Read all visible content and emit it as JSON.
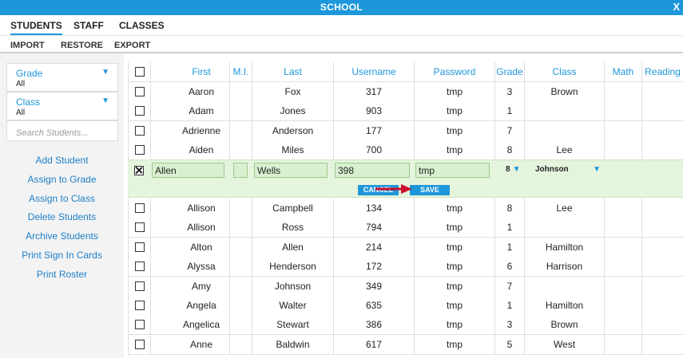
{
  "window": {
    "title": "SCHOOL",
    "close": "X"
  },
  "tabs": [
    {
      "label": "STUDENTS",
      "active": true
    },
    {
      "label": "STAFF",
      "active": false
    },
    {
      "label": "CLASSES",
      "active": false
    }
  ],
  "actions": {
    "import": "IMPORT",
    "restore": "RESTORE",
    "export": "EXPORT"
  },
  "filters": {
    "grade": {
      "label": "Grade",
      "value": "All"
    },
    "class": {
      "label": "Class",
      "value": "All"
    },
    "search_placeholder": "Search Students..."
  },
  "sidebar_links": [
    "Add Student",
    "Assign to Grade",
    "Assign to Class",
    "Delete Students",
    "Archive Students",
    "Print Sign In Cards",
    "Print Roster"
  ],
  "columns": [
    "First",
    "M.I.",
    "Last",
    "Username",
    "Password",
    "Grade",
    "Class",
    "Math",
    "Reading"
  ],
  "rows_top": [
    {
      "first": "Aaron",
      "mi": "",
      "last": "Fox",
      "username": "317",
      "password": "tmp",
      "grade": "3",
      "class": "Brown"
    },
    {
      "first": "Adam",
      "mi": "",
      "last": "Jones",
      "username": "903",
      "password": "tmp",
      "grade": "1",
      "class": ""
    },
    {
      "first": "Adrienne",
      "mi": "",
      "last": "Anderson",
      "username": "177",
      "password": "tmp",
      "grade": "7",
      "class": ""
    },
    {
      "first": "Aiden",
      "mi": "",
      "last": "Miles",
      "username": "700",
      "password": "tmp",
      "grade": "8",
      "class": "Lee"
    }
  ],
  "edit_row": {
    "first": "Allen",
    "mi": "",
    "last": "Wells",
    "username": "398",
    "password": "tmp",
    "grade": "8",
    "class": "Johnson",
    "cancel_label": "CANCEL",
    "save_label": "SAVE"
  },
  "rows_bottom": [
    {
      "first": "Allison",
      "mi": "",
      "last": "Campbell",
      "username": "134",
      "password": "tmp",
      "grade": "8",
      "class": "Lee"
    },
    {
      "first": "Allison",
      "mi": "",
      "last": "Ross",
      "username": "794",
      "password": "tmp",
      "grade": "1",
      "class": ""
    },
    {
      "first": "Alton",
      "mi": "",
      "last": "Allen",
      "username": "214",
      "password": "tmp",
      "grade": "1",
      "class": "Hamilton"
    },
    {
      "first": "Alyssa",
      "mi": "",
      "last": "Henderson",
      "username": "172",
      "password": "tmp",
      "grade": "6",
      "class": "Harrison"
    },
    {
      "first": "Amy",
      "mi": "",
      "last": "Johnson",
      "username": "349",
      "password": "tmp",
      "grade": "7",
      "class": ""
    },
    {
      "first": "Angela",
      "mi": "",
      "last": "Walter",
      "username": "635",
      "password": "tmp",
      "grade": "1",
      "class": "Hamilton"
    },
    {
      "first": "Angelica",
      "mi": "",
      "last": "Stewart",
      "username": "386",
      "password": "tmp",
      "grade": "3",
      "class": "Brown"
    },
    {
      "first": "Anne",
      "mi": "",
      "last": "Baldwin",
      "username": "617",
      "password": "tmp",
      "grade": "5",
      "class": "West"
    }
  ],
  "colors": {
    "accent": "#1e97da",
    "edit_row_bg": "#e4f4dd",
    "arrow": "#c8102e"
  },
  "icons": {
    "close": "close-icon",
    "dropdown": "caret-down-icon",
    "checkbox": "checkbox-icon",
    "pointer": "arrow-pointer-icon"
  }
}
